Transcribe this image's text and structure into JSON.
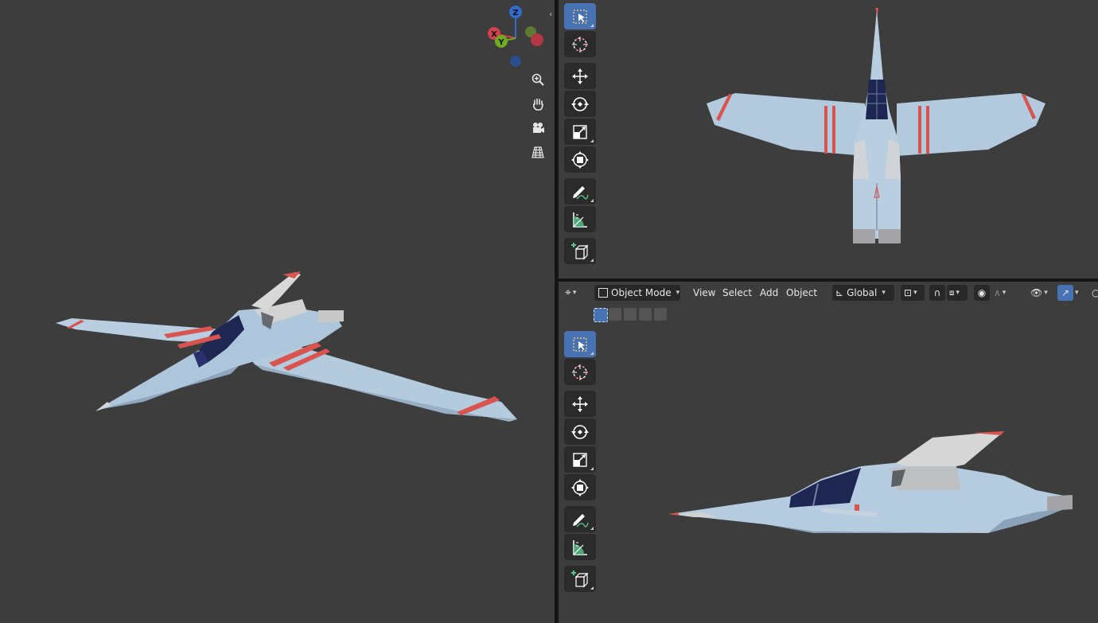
{
  "header": {
    "mode_label": "Object Mode",
    "menu_view": "View",
    "menu_select": "Select",
    "menu_add": "Add",
    "menu_object": "Object",
    "transform_orientation": "Global"
  },
  "gizmo": {
    "axis_z": "Z",
    "axis_x": "X",
    "axis_y": "Y"
  },
  "colors": {
    "viewport_bg": "#3d3d3d",
    "active_tool": "#4772b3",
    "hull": "#b7cde0",
    "stripe": "#d9534f",
    "cockpit": "#1e2752",
    "axis_x": "#d0424f",
    "axis_y": "#6faa1f",
    "axis_z": "#2f6ccc"
  },
  "tools": [
    "select-box",
    "cursor",
    "move",
    "rotate",
    "scale",
    "transform",
    "annotate",
    "measure",
    "add-cube"
  ],
  "navigation_icons": [
    "zoom-icon",
    "hand-pan-icon",
    "camera-icon",
    "grid-view-icon"
  ]
}
